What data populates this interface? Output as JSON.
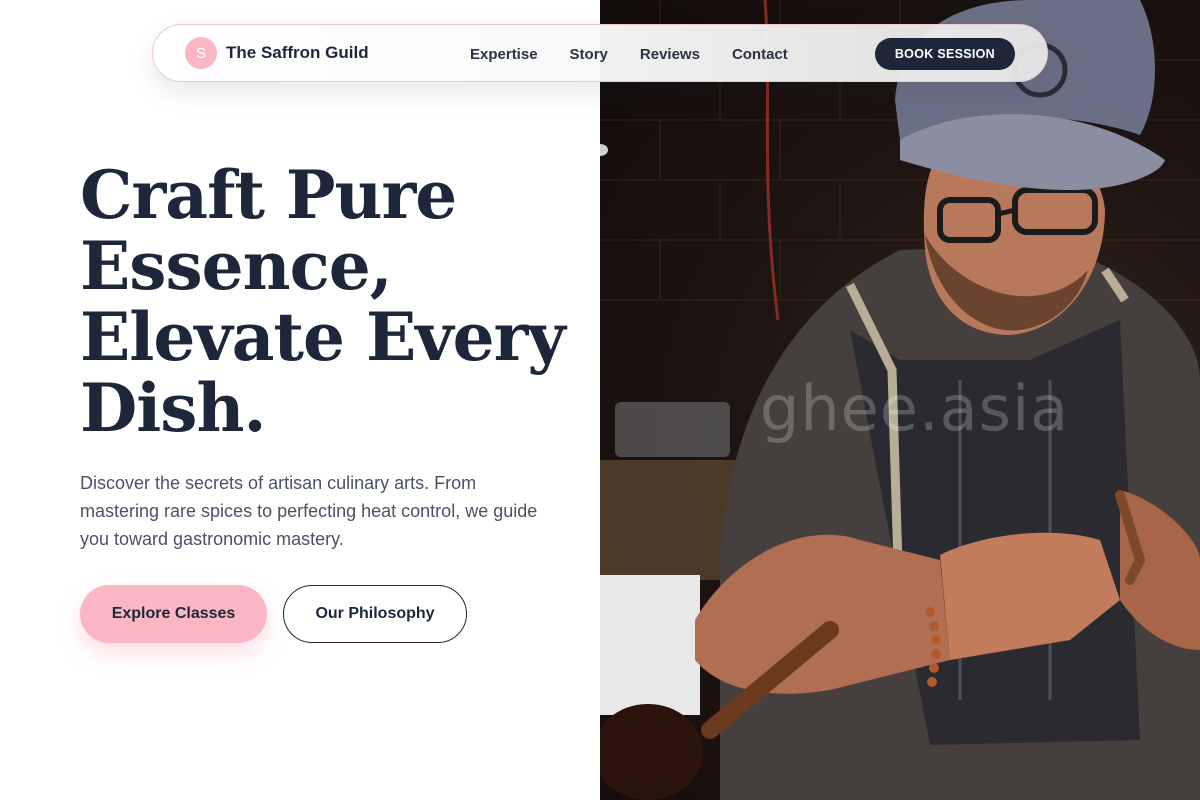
{
  "nav": {
    "brand_initial": "S",
    "brand_name": "The Saffron Guild",
    "links": [
      "Expertise",
      "Story",
      "Reviews",
      "Contact"
    ],
    "cta_label": "BOOK SESSION"
  },
  "hero": {
    "title_lines": [
      "Craft Pure",
      "Essence,",
      "Elevate Every",
      "Dish."
    ],
    "description": "Discover the secrets of artisan culinary arts. From mastering rare spices to perfecting heat control, we guide you toward gastronomic mastery.",
    "primary_button": "Explore Classes",
    "secondary_button": "Our Philosophy"
  },
  "photo": {
    "watermark": "ghee.asia",
    "subject": "craftsman-in-cap-and-apron"
  },
  "colors": {
    "navy": "#1e2739",
    "pink": "#fbb6c6",
    "text_muted": "#4a5263"
  }
}
